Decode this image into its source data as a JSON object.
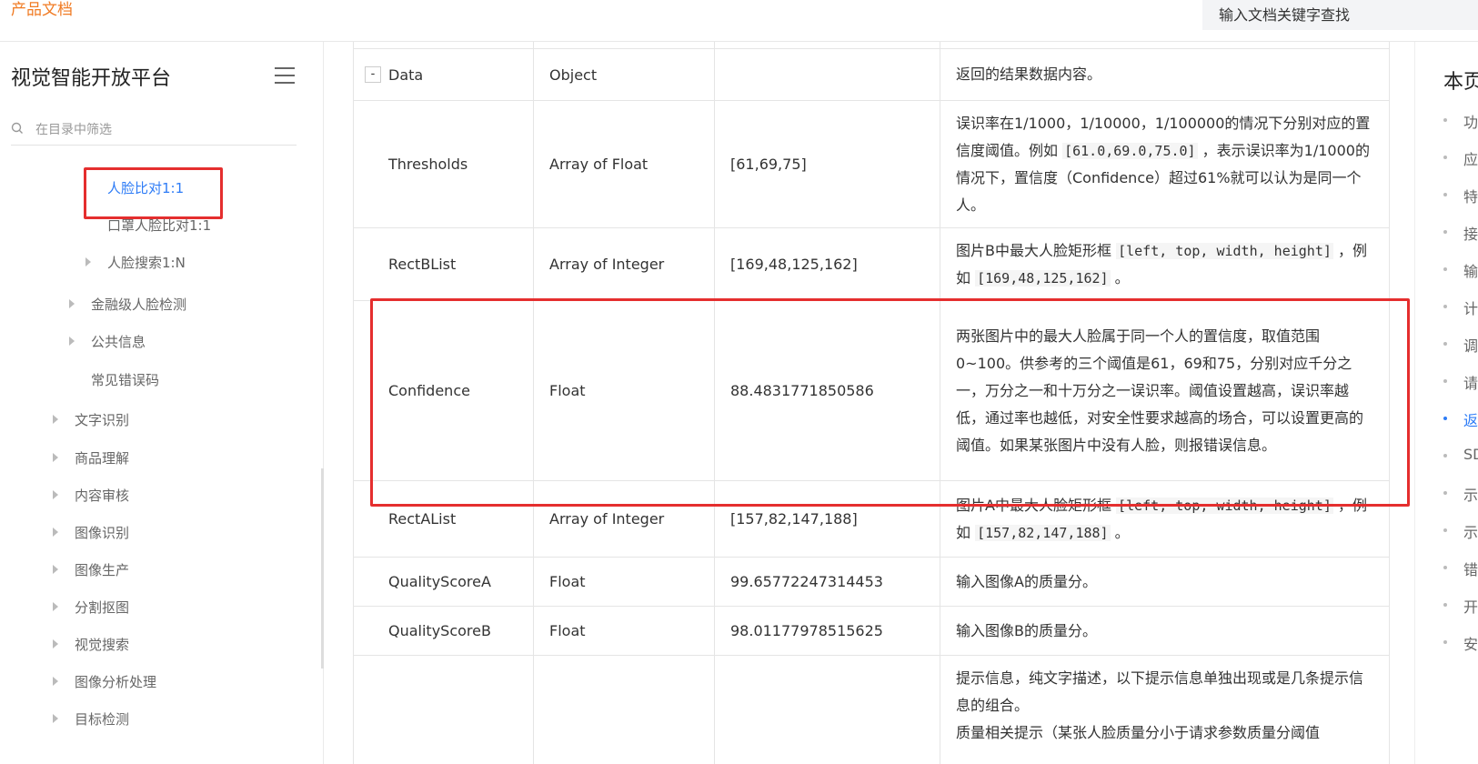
{
  "topbar": {
    "product_docs": "产品文档",
    "search_placeholder": "输入文档关键字查找"
  },
  "sidebar": {
    "title": "视觉智能开放平台",
    "filter_placeholder": "在目录中筛选",
    "items": [
      {
        "label": "人脸比对1:1",
        "active": true
      },
      {
        "label": "口罩人脸比对1:1"
      },
      {
        "label": "人脸搜索1:N"
      },
      {
        "label": "金融级人脸检测"
      },
      {
        "label": "公共信息"
      },
      {
        "label": "常见错误码"
      },
      {
        "label": "文字识别"
      },
      {
        "label": "商品理解"
      },
      {
        "label": "内容审核"
      },
      {
        "label": "图像识别"
      },
      {
        "label": "图像生产"
      },
      {
        "label": "分割抠图"
      },
      {
        "label": "视觉搜索"
      },
      {
        "label": "图像分析处理"
      },
      {
        "label": "目标检测"
      }
    ]
  },
  "table": {
    "collapse_symbol": "-",
    "rows": [
      {
        "name": "Data",
        "type": "Object",
        "example": "",
        "desc": "返回的结果数据内容。"
      },
      {
        "name": "Thresholds",
        "type": "Array of Float",
        "example": "[61,69,75]",
        "desc_pre": "误识率在1/1000，1/10000，1/100000的情况下分别对应的置信度阈值。例如 ",
        "desc_code": "[61.0,69.0,75.0]",
        "desc_post": " ，表示误识率为1/1000的情况下，置信度（Confidence）超过61%就可以认为是同一个人。"
      },
      {
        "name": "RectBList",
        "type": "Array of Integer",
        "example": "[169,48,125,162]",
        "desc_pre": "图片B中最大人脸矩形框 ",
        "desc_code": "[left, top, width, height]",
        "desc_mid": " ，例如 ",
        "desc_code2": "[169,48,125,162]",
        "desc_post": " 。"
      },
      {
        "name": "Confidence",
        "type": "Float",
        "example": "88.4831771850586",
        "desc": "两张图片中的最大人脸属于同一个人的置信度，取值范围0~100。供参考的三个阈值是61，69和75，分别对应千分之一，万分之一和十万分之一误识率。阈值设置越高，误识率越低，通过率也越低，对安全性要求越高的场合，可以设置更高的阈值。如果某张图片中没有人脸，则报错误信息。"
      },
      {
        "name": "RectAList",
        "type": "Array of Integer",
        "example": "[157,82,147,188]",
        "desc_pre": "图片A中最大人脸矩形框 ",
        "desc_code": "[left, top, width, height]",
        "desc_mid": " ，例如 ",
        "desc_code2": "[157,82,147,188]",
        "desc_post": " 。"
      },
      {
        "name": "QualityScoreA",
        "type": "Float",
        "example": "99.65772247314453",
        "desc": "输入图像A的质量分。"
      },
      {
        "name": "QualityScoreB",
        "type": "Float",
        "example": "98.01177978515625",
        "desc": "输入图像B的质量分。"
      },
      {
        "name": "",
        "type": "",
        "example": "",
        "desc": "提示信息，纯文字描述，以下提示信息单独出现或是几条提示信息的组合。",
        "desc2": "质量相关提示（某张人脸质量分小于请求参数质量分阈值"
      }
    ]
  },
  "toc": {
    "title": "本页",
    "items": [
      {
        "label": "功"
      },
      {
        "label": "应"
      },
      {
        "label": "特"
      },
      {
        "label": "接"
      },
      {
        "label": "输"
      },
      {
        "label": "计"
      },
      {
        "label": "调"
      },
      {
        "label": "请"
      },
      {
        "label": "返",
        "active": true
      },
      {
        "label": "SD"
      },
      {
        "label": "示"
      },
      {
        "label": "示"
      },
      {
        "label": "错"
      },
      {
        "label": "开"
      },
      {
        "label": "安"
      }
    ]
  },
  "colors": {
    "accent": "#2e7cf6",
    "brand": "#f07a22",
    "highlight": "#e52e2e"
  }
}
